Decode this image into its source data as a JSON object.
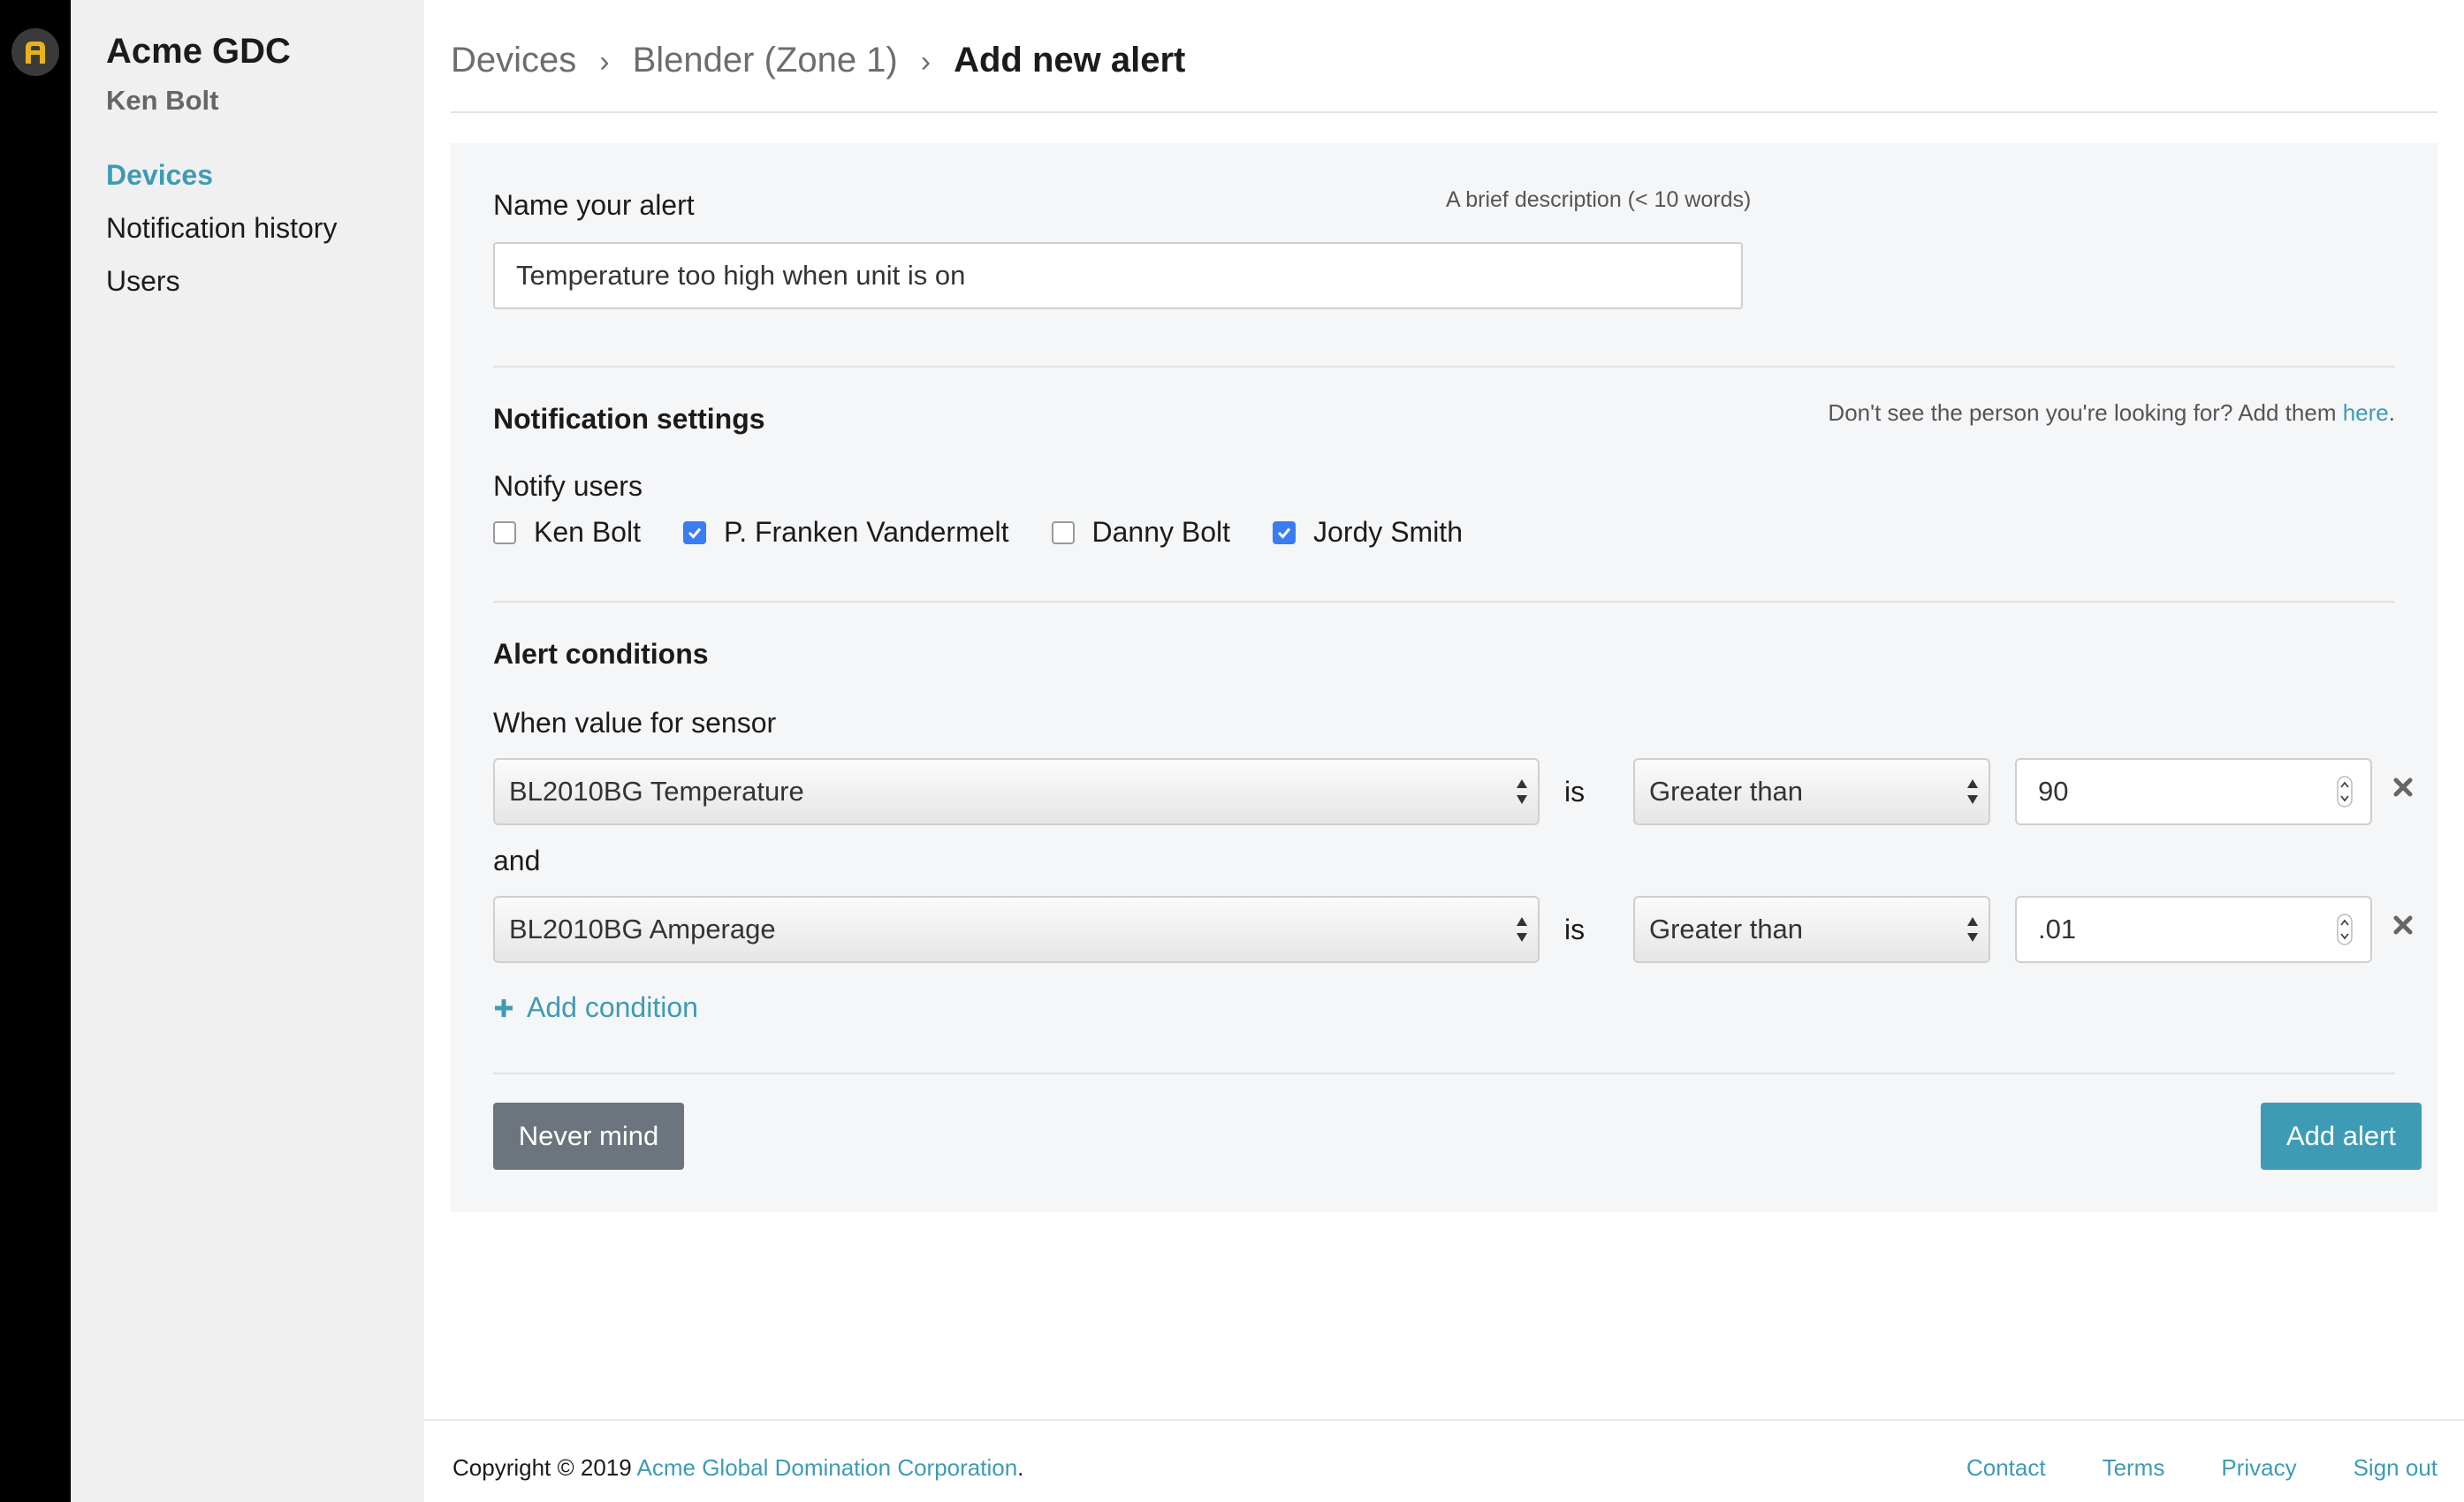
{
  "org": {
    "name": "Acme GDC",
    "user": "Ken Bolt"
  },
  "nav": [
    {
      "label": "Devices",
      "active": true
    },
    {
      "label": "Notification history",
      "active": false
    },
    {
      "label": "Users",
      "active": false
    }
  ],
  "breadcrumb": {
    "items": [
      "Devices",
      "Blender (Zone 1)"
    ],
    "current": "Add new alert"
  },
  "form": {
    "name_label": "Name your alert",
    "name_hint": "A brief description (< 10 words)",
    "name_value": "Temperature too high when unit is on",
    "notification": {
      "title": "Notification settings",
      "hint_prefix": "Don't see the person you're looking for? Add them ",
      "hint_link": "here",
      "hint_suffix": ".",
      "notify_label": "Notify users",
      "users": [
        {
          "name": "Ken Bolt",
          "checked": false
        },
        {
          "name": "P. Franken Vandermelt",
          "checked": true
        },
        {
          "name": "Danny Bolt",
          "checked": false
        },
        {
          "name": "Jordy Smith",
          "checked": true
        }
      ]
    },
    "conditions": {
      "title": "Alert conditions",
      "when_label": "When value for sensor",
      "is_label": "is",
      "and_label": "and",
      "rows": [
        {
          "sensor": "BL2010BG Temperature",
          "operator": "Greater than",
          "value": "90"
        },
        {
          "sensor": "BL2010BG Amperage",
          "operator": "Greater than",
          "value": ".01"
        }
      ],
      "add_label": "Add condition"
    },
    "cancel_label": "Never mind",
    "submit_label": "Add alert"
  },
  "footer": {
    "copyright_prefix": "Copyright © 2019 ",
    "company": "Acme Global Domination Corporation",
    "copyright_suffix": ".",
    "links": [
      "Contact",
      "Terms",
      "Privacy",
      "Sign out"
    ]
  },
  "colors": {
    "accent": "#3e9bb5",
    "checkbox": "#3b7cf0",
    "secondary_button": "#6c757d"
  }
}
